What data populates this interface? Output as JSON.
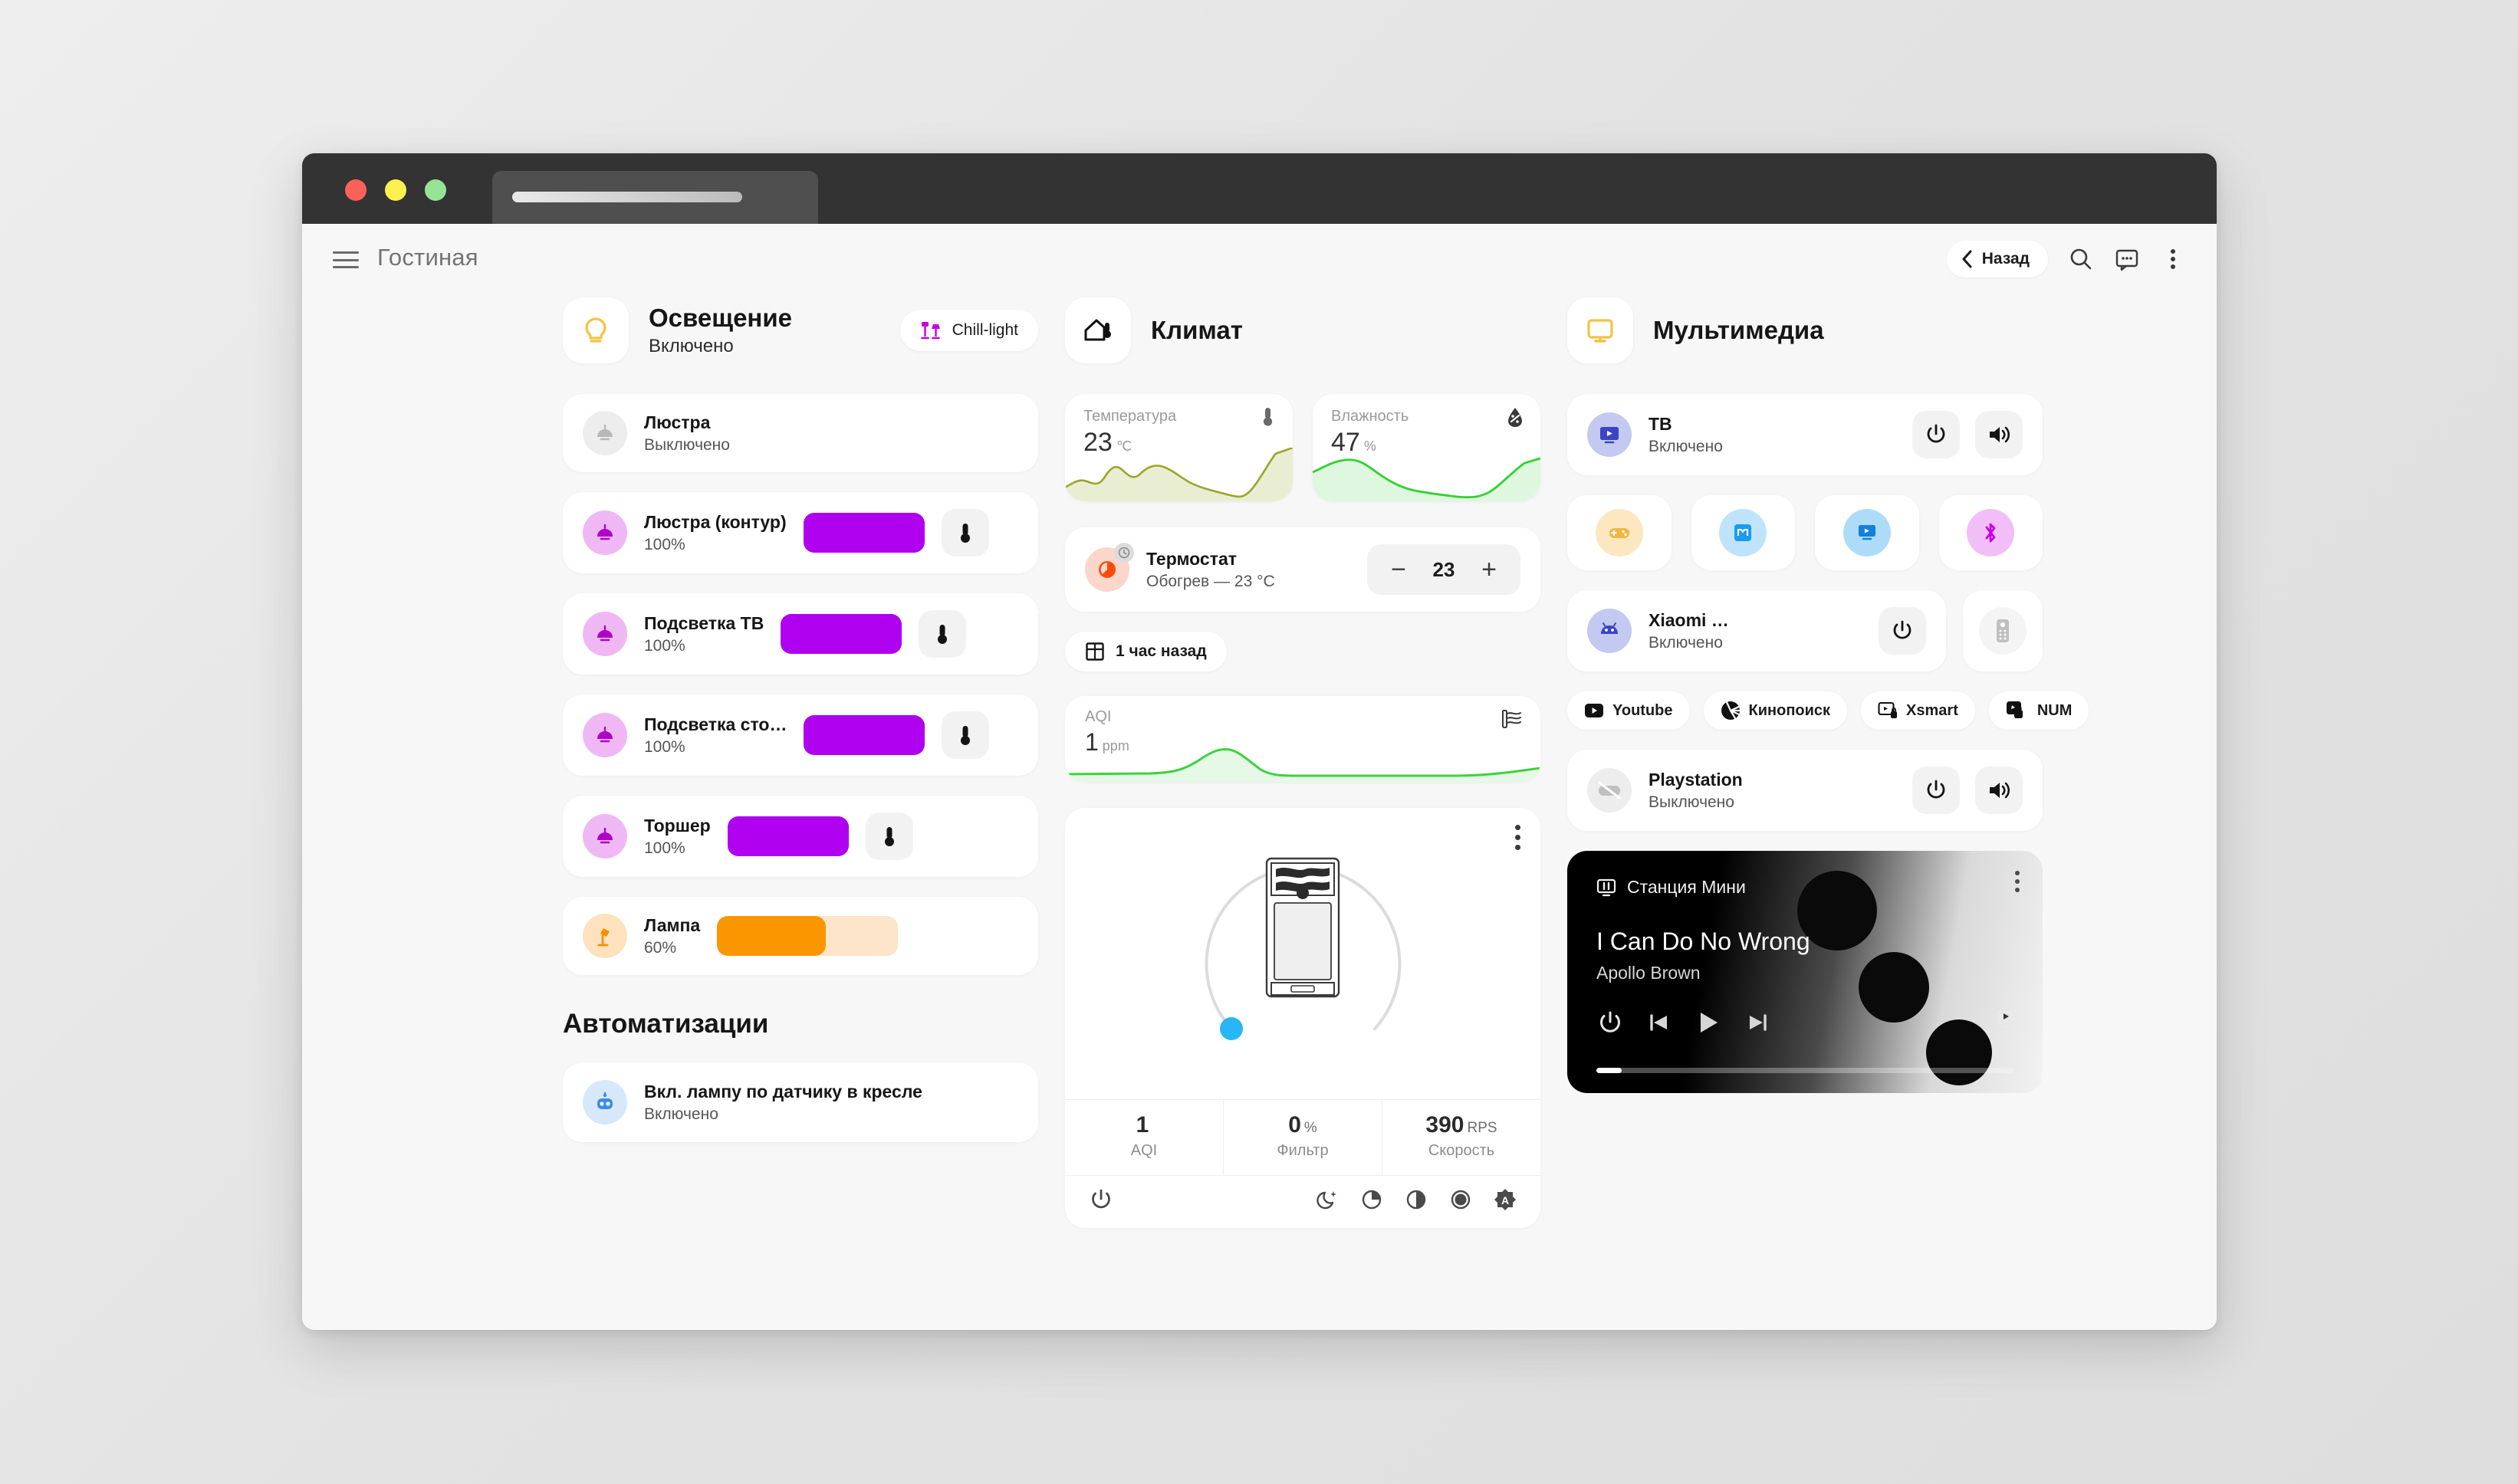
{
  "window": {
    "traffic_lights": [
      "close",
      "minimize",
      "maximize"
    ]
  },
  "topbar": {
    "room_title": "Гостиная",
    "back_label": "Назад",
    "icons": [
      "menu-icon",
      "search-icon",
      "chat-icon",
      "more-vertical-icon"
    ]
  },
  "lighting": {
    "title": "Освещение",
    "status": "Включено",
    "scene": {
      "label": "Chill-light",
      "icon": "floor-lamp-icon",
      "color": "#C800E0"
    },
    "devices": [
      {
        "name": "Люстра",
        "sub": "Выключено",
        "icon": "chandelier-icon",
        "on": false,
        "slider": null,
        "has_temp_button": false,
        "avatar_bg": "#EDEDED",
        "icon_color": "#B9B9B9"
      },
      {
        "name": "Люстра (контур)",
        "sub": "100%",
        "icon": "chandelier-icon",
        "on": true,
        "slider": 100,
        "has_temp_button": true,
        "avatar_bg": "#EFB8F5",
        "icon_color": "#AF00C8",
        "fill": "#AF00F0",
        "track": "#AF00F0"
      },
      {
        "name": "Подсветка ТВ",
        "sub": "100%",
        "icon": "chandelier-icon",
        "on": true,
        "slider": 100,
        "has_temp_button": true,
        "avatar_bg": "#EFB8F5",
        "icon_color": "#AF00C8",
        "fill": "#AF00F0",
        "track": "#AF00F0"
      },
      {
        "name": "Подсветка сто…",
        "sub": "100%",
        "icon": "chandelier-icon",
        "on": true,
        "slider": 100,
        "has_temp_button": true,
        "avatar_bg": "#EFB8F5",
        "icon_color": "#AF00C8",
        "fill": "#AF00F0",
        "track": "#AF00F0"
      },
      {
        "name": "Торшер",
        "sub": "100%",
        "icon": "chandelier-icon",
        "on": true,
        "slider": 100,
        "has_temp_button": true,
        "avatar_bg": "#EFB8F5",
        "icon_color": "#AF00C8",
        "fill": "#AF00F0",
        "track": "#AF00F0"
      },
      {
        "name": "Лампа",
        "sub": "60%",
        "icon": "desk-lamp-icon",
        "on": true,
        "slider": 60,
        "has_temp_button": false,
        "avatar_bg": "#FDE2BD",
        "icon_color": "#F59000",
        "fill": "#FA9600",
        "track": "#FCE5C8"
      }
    ],
    "automations_title": "Автоматизации",
    "automations": [
      {
        "name": "Вкл. лампу по датчику в кресле",
        "sub": "Включено",
        "icon": "robot-icon",
        "avatar_bg": "#D7E8FB",
        "icon_color": "#3C8CE8"
      }
    ]
  },
  "climate": {
    "title": "Климат",
    "sensors": [
      {
        "label": "Температура",
        "value": "23",
        "unit": "℃",
        "icon": "thermometer-icon",
        "line_color": "#9AA62B",
        "fill_color": "#E9EDD2"
      },
      {
        "label": "Влажность",
        "value": "47",
        "unit": "%",
        "icon": "humidity-icon",
        "line_color": "#2FD22F",
        "fill_color": "#DFF6DF"
      }
    ],
    "thermostat": {
      "name": "Термостат",
      "sub": "Обогрев — 23 °C",
      "value": "23",
      "minus_label": "−",
      "plus_label": "+",
      "icon": "thermostat-icon",
      "badge_icon": "clock-icon",
      "avatar_bg": "#FBD6CB",
      "icon_color": "#FA4B0A"
    },
    "time_chip": {
      "label": "1 час назад",
      "icon": "window-icon"
    },
    "aqi_card": {
      "label": "AQI",
      "value": "1",
      "unit": "ppm",
      "icon": "air-filter-icon",
      "line_color": "#3ED13E",
      "fill_color": "#E6F9E6"
    },
    "purifier": {
      "device_icon": "air-purifier-icon",
      "dial_value": 1,
      "dial_handle_color": "#29B6F6",
      "dial_track_color": "#DCDCDC",
      "stats": [
        {
          "value": "1",
          "unit": "",
          "label": "AQI"
        },
        {
          "value": "0",
          "unit": "%",
          "label": "Фильтр"
        },
        {
          "value": "390",
          "unit": "RPS",
          "label": "Скорость"
        }
      ],
      "controls": [
        "power-icon",
        "night-mode-icon",
        "fan-low-icon",
        "fan-medium-icon",
        "fan-high-icon",
        "auto-mode-icon"
      ]
    }
  },
  "multimedia": {
    "title": "Мультимедиа",
    "devices": [
      {
        "name": "ТВ",
        "sub": "Включено",
        "icon": "tv-play-icon",
        "avatar_bg": "#C3C9F0",
        "icon_color": "#3B45C4",
        "buttons": [
          "power-icon",
          "volume-icon"
        ]
      },
      {
        "name": "Xiaomi …",
        "sub": "Включено",
        "icon": "android-icon",
        "avatar_bg": "#C3C9F0",
        "icon_color": "#3B45C4",
        "buttons": [
          "power-icon"
        ]
      },
      {
        "name": "Playstation",
        "sub": "Выключено",
        "icon": "gamepad-off-icon",
        "avatar_bg": "#EDEDED",
        "icon_color": "#B9B9B9",
        "buttons": [
          "power-icon",
          "volume-icon"
        ]
      }
    ],
    "tiles": [
      {
        "icon": "gamepad-icon",
        "bg": "#FDE7C0",
        "color": "#F2B544"
      },
      {
        "icon": "mi-icon",
        "bg": "#BFE3FB",
        "color": "#1A9CF0"
      },
      {
        "icon": "tv-play-icon",
        "bg": "#AEDCF8",
        "color": "#1480D8"
      },
      {
        "icon": "bluetooth-icon",
        "bg": "#F2BEF7",
        "color": "#C800E0"
      }
    ],
    "remote_button": {
      "icon": "remote-control-icon"
    },
    "apps": [
      {
        "label": "Youtube",
        "icon": "youtube-icon"
      },
      {
        "label": "Кинопоиск",
        "icon": "kinopoisk-icon"
      },
      {
        "label": "Xsmart",
        "icon": "xsmart-icon"
      },
      {
        "label": "NUM",
        "icon": "num-icon"
      }
    ],
    "player": {
      "source": "Станция Мини",
      "source_icon": "speaker-icon",
      "track_title": "I Can Do No Wrong",
      "artist": "Apollo Brown",
      "progress_percent": 6,
      "controls": [
        "power-icon",
        "previous-icon",
        "play-icon",
        "next-icon"
      ],
      "cast_icon": "cast-icon",
      "menu_icon": "more-vertical-icon"
    }
  }
}
